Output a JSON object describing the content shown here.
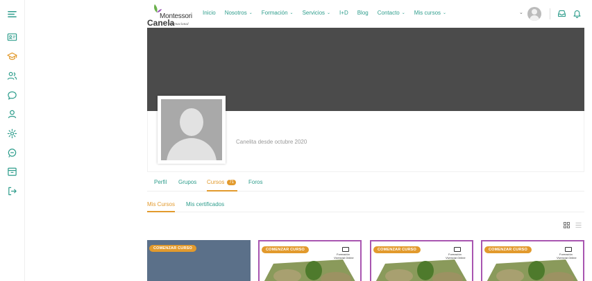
{
  "header": {
    "logo": {
      "line1": "Montessori",
      "line2": "Canela",
      "line3": "internacional"
    },
    "nav": [
      {
        "label": "Inicio",
        "has_dropdown": false
      },
      {
        "label": "Nosotros",
        "has_dropdown": true
      },
      {
        "label": "Formación",
        "has_dropdown": true
      },
      {
        "label": "Servicios",
        "has_dropdown": true
      },
      {
        "label": "I+D",
        "has_dropdown": false
      },
      {
        "label": "Blog",
        "has_dropdown": false
      },
      {
        "label": "Contacto",
        "has_dropdown": true
      },
      {
        "label": "Mis cursos",
        "has_dropdown": true
      }
    ],
    "icons": [
      "menu-icon",
      "user-avatar",
      "inbox-icon",
      "bell-icon"
    ]
  },
  "sidebar": {
    "items": [
      "id-card-icon",
      "graduation-cap-icon",
      "users-icon",
      "chat-icon",
      "user-icon",
      "gear-icon",
      "message-icon",
      "archive-icon",
      "logout-icon"
    ]
  },
  "profile": {
    "member_since": "Canelita desde octubre 2020"
  },
  "tabs": [
    {
      "label": "Perfil"
    },
    {
      "label": "Grupos"
    },
    {
      "label": "Cursos",
      "badge": "71",
      "active": true
    },
    {
      "label": "Foros"
    }
  ],
  "subtabs": [
    {
      "label": "Mis Cursos",
      "active": true
    },
    {
      "label": "Mis certificados"
    }
  ],
  "courses": [
    {
      "ribbon": "COMENZAR CURSO",
      "style": "plain"
    },
    {
      "ribbon": "COMENZAR CURSO",
      "style": "framed",
      "mark_line1": "Formación",
      "mark_line2": "Vivencial Online"
    },
    {
      "ribbon": "COMENZAR CURSO",
      "style": "framed",
      "mark_line1": "Formación",
      "mark_line2": "Vivencial Online"
    },
    {
      "ribbon": "COMENZAR CURSO",
      "style": "framed",
      "mark_line1": "Formación",
      "mark_line2": "Vivencial Online"
    }
  ],
  "colors": {
    "accent": "#e29a2d",
    "nav_text": "#2e9d8c",
    "banner": "#4b4b4b",
    "card_frame": "#a855b0"
  }
}
